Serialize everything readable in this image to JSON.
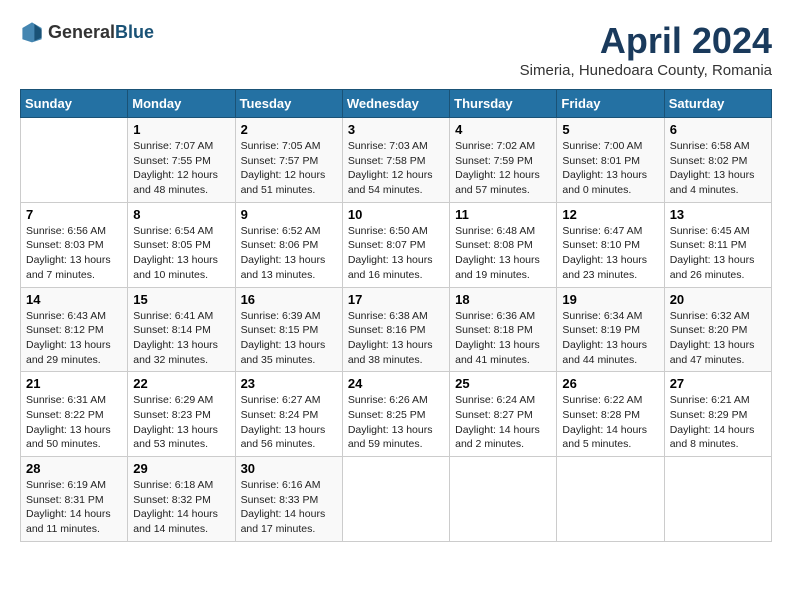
{
  "header": {
    "logo_general": "General",
    "logo_blue": "Blue",
    "month_title": "April 2024",
    "subtitle": "Simeria, Hunedoara County, Romania"
  },
  "days_of_week": [
    "Sunday",
    "Monday",
    "Tuesday",
    "Wednesday",
    "Thursday",
    "Friday",
    "Saturday"
  ],
  "weeks": [
    [
      {
        "day": "",
        "info": ""
      },
      {
        "day": "1",
        "info": "Sunrise: 7:07 AM\nSunset: 7:55 PM\nDaylight: 12 hours\nand 48 minutes."
      },
      {
        "day": "2",
        "info": "Sunrise: 7:05 AM\nSunset: 7:57 PM\nDaylight: 12 hours\nand 51 minutes."
      },
      {
        "day": "3",
        "info": "Sunrise: 7:03 AM\nSunset: 7:58 PM\nDaylight: 12 hours\nand 54 minutes."
      },
      {
        "day": "4",
        "info": "Sunrise: 7:02 AM\nSunset: 7:59 PM\nDaylight: 12 hours\nand 57 minutes."
      },
      {
        "day": "5",
        "info": "Sunrise: 7:00 AM\nSunset: 8:01 PM\nDaylight: 13 hours\nand 0 minutes."
      },
      {
        "day": "6",
        "info": "Sunrise: 6:58 AM\nSunset: 8:02 PM\nDaylight: 13 hours\nand 4 minutes."
      }
    ],
    [
      {
        "day": "7",
        "info": "Sunrise: 6:56 AM\nSunset: 8:03 PM\nDaylight: 13 hours\nand 7 minutes."
      },
      {
        "day": "8",
        "info": "Sunrise: 6:54 AM\nSunset: 8:05 PM\nDaylight: 13 hours\nand 10 minutes."
      },
      {
        "day": "9",
        "info": "Sunrise: 6:52 AM\nSunset: 8:06 PM\nDaylight: 13 hours\nand 13 minutes."
      },
      {
        "day": "10",
        "info": "Sunrise: 6:50 AM\nSunset: 8:07 PM\nDaylight: 13 hours\nand 16 minutes."
      },
      {
        "day": "11",
        "info": "Sunrise: 6:48 AM\nSunset: 8:08 PM\nDaylight: 13 hours\nand 19 minutes."
      },
      {
        "day": "12",
        "info": "Sunrise: 6:47 AM\nSunset: 8:10 PM\nDaylight: 13 hours\nand 23 minutes."
      },
      {
        "day": "13",
        "info": "Sunrise: 6:45 AM\nSunset: 8:11 PM\nDaylight: 13 hours\nand 26 minutes."
      }
    ],
    [
      {
        "day": "14",
        "info": "Sunrise: 6:43 AM\nSunset: 8:12 PM\nDaylight: 13 hours\nand 29 minutes."
      },
      {
        "day": "15",
        "info": "Sunrise: 6:41 AM\nSunset: 8:14 PM\nDaylight: 13 hours\nand 32 minutes."
      },
      {
        "day": "16",
        "info": "Sunrise: 6:39 AM\nSunset: 8:15 PM\nDaylight: 13 hours\nand 35 minutes."
      },
      {
        "day": "17",
        "info": "Sunrise: 6:38 AM\nSunset: 8:16 PM\nDaylight: 13 hours\nand 38 minutes."
      },
      {
        "day": "18",
        "info": "Sunrise: 6:36 AM\nSunset: 8:18 PM\nDaylight: 13 hours\nand 41 minutes."
      },
      {
        "day": "19",
        "info": "Sunrise: 6:34 AM\nSunset: 8:19 PM\nDaylight: 13 hours\nand 44 minutes."
      },
      {
        "day": "20",
        "info": "Sunrise: 6:32 AM\nSunset: 8:20 PM\nDaylight: 13 hours\nand 47 minutes."
      }
    ],
    [
      {
        "day": "21",
        "info": "Sunrise: 6:31 AM\nSunset: 8:22 PM\nDaylight: 13 hours\nand 50 minutes."
      },
      {
        "day": "22",
        "info": "Sunrise: 6:29 AM\nSunset: 8:23 PM\nDaylight: 13 hours\nand 53 minutes."
      },
      {
        "day": "23",
        "info": "Sunrise: 6:27 AM\nSunset: 8:24 PM\nDaylight: 13 hours\nand 56 minutes."
      },
      {
        "day": "24",
        "info": "Sunrise: 6:26 AM\nSunset: 8:25 PM\nDaylight: 13 hours\nand 59 minutes."
      },
      {
        "day": "25",
        "info": "Sunrise: 6:24 AM\nSunset: 8:27 PM\nDaylight: 14 hours\nand 2 minutes."
      },
      {
        "day": "26",
        "info": "Sunrise: 6:22 AM\nSunset: 8:28 PM\nDaylight: 14 hours\nand 5 minutes."
      },
      {
        "day": "27",
        "info": "Sunrise: 6:21 AM\nSunset: 8:29 PM\nDaylight: 14 hours\nand 8 minutes."
      }
    ],
    [
      {
        "day": "28",
        "info": "Sunrise: 6:19 AM\nSunset: 8:31 PM\nDaylight: 14 hours\nand 11 minutes."
      },
      {
        "day": "29",
        "info": "Sunrise: 6:18 AM\nSunset: 8:32 PM\nDaylight: 14 hours\nand 14 minutes."
      },
      {
        "day": "30",
        "info": "Sunrise: 6:16 AM\nSunset: 8:33 PM\nDaylight: 14 hours\nand 17 minutes."
      },
      {
        "day": "",
        "info": ""
      },
      {
        "day": "",
        "info": ""
      },
      {
        "day": "",
        "info": ""
      },
      {
        "day": "",
        "info": ""
      }
    ]
  ]
}
